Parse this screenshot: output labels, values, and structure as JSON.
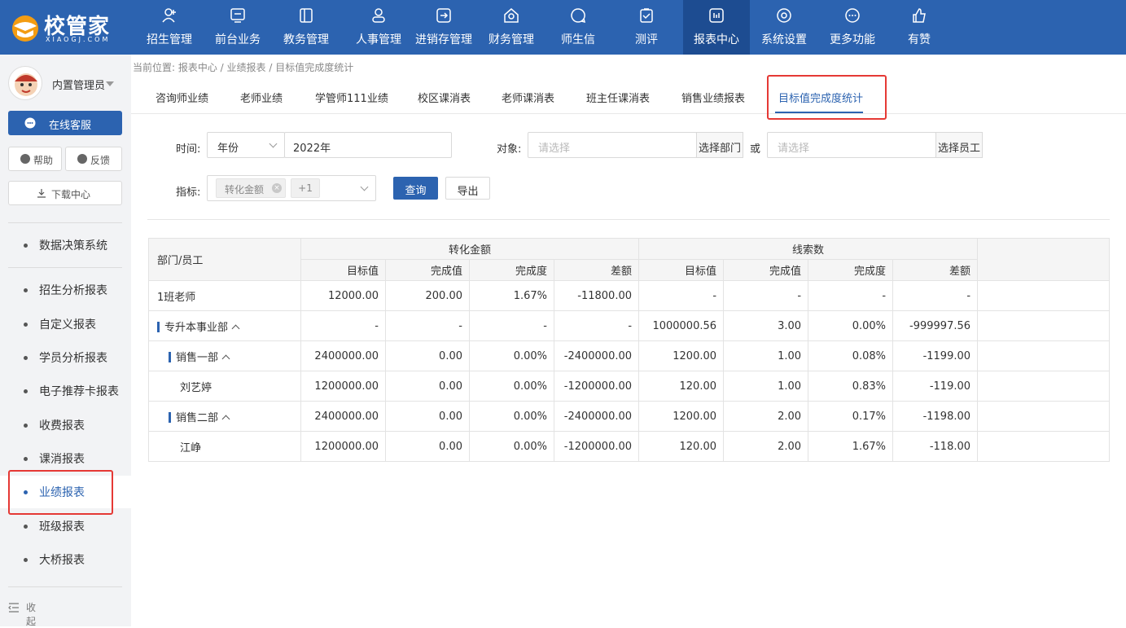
{
  "logo": {
    "title": "校管家",
    "subtitle": "XIAOGJ.COM"
  },
  "nav": [
    {
      "label": "招生管理",
      "icon": "person-add-icon"
    },
    {
      "label": "前台业务",
      "icon": "monitor-icon"
    },
    {
      "label": "教务管理",
      "icon": "book-icon"
    },
    {
      "label": "人事管理",
      "icon": "user-icon"
    },
    {
      "label": "进销存管理",
      "icon": "inventory-icon"
    },
    {
      "label": "财务管理",
      "icon": "yuan-icon"
    },
    {
      "label": "师生信",
      "icon": "chat-icon"
    },
    {
      "label": "测评",
      "icon": "clipboard-check-icon"
    },
    {
      "label": "报表中心",
      "icon": "report-icon",
      "active": true
    },
    {
      "label": "系统设置",
      "icon": "settings-icon"
    },
    {
      "label": "更多功能",
      "icon": "more-icon"
    },
    {
      "label": "有赞",
      "icon": "thumbs-up-icon"
    }
  ],
  "sidebar": {
    "user_name": "内置管理员",
    "service_label": "在线客服",
    "help_label": "帮助",
    "feedback_label": "反馈",
    "download_label": "下载中心",
    "decision_label": "数据决策系统",
    "items": [
      {
        "label": "招生分析报表"
      },
      {
        "label": "自定义报表"
      },
      {
        "label": "学员分析报表"
      },
      {
        "label": "电子推荐卡报表"
      },
      {
        "label": "收费报表"
      },
      {
        "label": "课消报表"
      },
      {
        "label": "业绩报表",
        "active": true
      },
      {
        "label": "班级报表"
      },
      {
        "label": "大桥报表"
      }
    ],
    "collapse_label": "收起"
  },
  "breadcrumb": "当前位置: 报表中心 / 业绩报表 / 目标值完成度统计",
  "tabs": [
    {
      "label": "咨询师业绩"
    },
    {
      "label": "老师业绩"
    },
    {
      "label": "学管师111业绩"
    },
    {
      "label": "校区课消表"
    },
    {
      "label": "老师课消表"
    },
    {
      "label": "班主任课消表"
    },
    {
      "label": "销售业绩报表"
    },
    {
      "label": "目标值完成度统计",
      "active": true
    }
  ],
  "filters": {
    "time_label": "时间:",
    "time_unit": "年份",
    "time_value": "2022年",
    "target_label": "对象:",
    "dept_placeholder": "请选择",
    "choose_dept_label": "选择部门",
    "or_label": "或",
    "staff_placeholder": "请选择",
    "choose_staff_label": "选择员工",
    "metric_label": "指标:",
    "metric_tag": "转化金额",
    "metric_more": "+1",
    "query_label": "查询",
    "export_label": "导出"
  },
  "table": {
    "first_header": "部门/员工",
    "groups": [
      "转化金额",
      "线索数"
    ],
    "sub_headers": [
      "目标值",
      "完成值",
      "完成度",
      "差额",
      "目标值",
      "完成值",
      "完成度",
      "差额"
    ],
    "rows": [
      {
        "name": "1班老师",
        "level": 0,
        "group": false,
        "cells": [
          "12000.00",
          "200.00",
          "1.67%",
          "-11800.00",
          "-",
          "-",
          "-",
          "-"
        ]
      },
      {
        "name": "专升本事业部",
        "level": 0,
        "group": true,
        "cells": [
          "-",
          "-",
          "-",
          "-",
          "1000000.56",
          "3.00",
          "0.00%",
          "-999997.56"
        ]
      },
      {
        "name": "销售一部",
        "level": 1,
        "group": true,
        "cells": [
          "2400000.00",
          "0.00",
          "0.00%",
          "-2400000.00",
          "1200.00",
          "1.00",
          "0.08%",
          "-1199.00"
        ]
      },
      {
        "name": "刘艺婷",
        "level": 2,
        "group": false,
        "cells": [
          "1200000.00",
          "0.00",
          "0.00%",
          "-1200000.00",
          "120.00",
          "1.00",
          "0.83%",
          "-119.00"
        ]
      },
      {
        "name": "销售二部",
        "level": 1,
        "group": true,
        "cells": [
          "2400000.00",
          "0.00",
          "0.00%",
          "-2400000.00",
          "1200.00",
          "2.00",
          "0.17%",
          "-1198.00"
        ]
      },
      {
        "name": "江峥",
        "level": 2,
        "group": false,
        "cells": [
          "1200000.00",
          "0.00",
          "0.00%",
          "-1200000.00",
          "120.00",
          "2.00",
          "1.67%",
          "-118.00"
        ]
      }
    ]
  },
  "colors": {
    "brand": "#2c63b0",
    "highlight": "#e53935"
  }
}
